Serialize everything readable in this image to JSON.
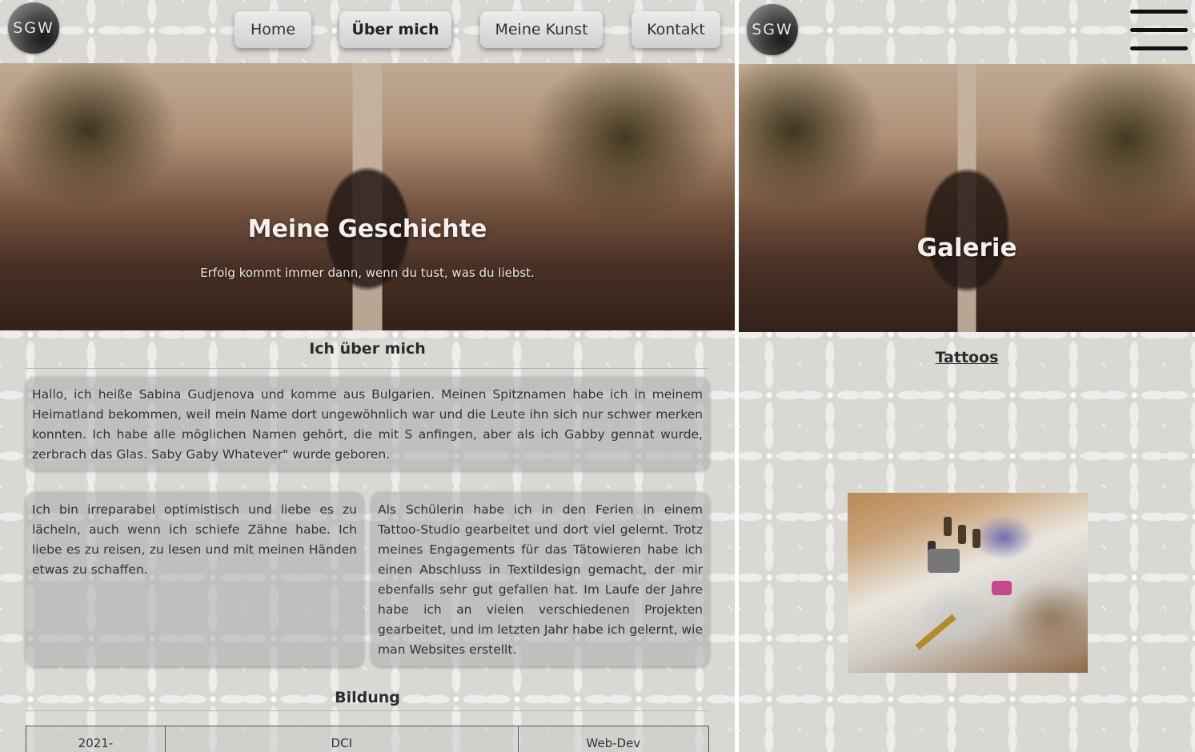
{
  "left": {
    "logo": "SGW",
    "nav": [
      {
        "label": "Home",
        "active": false
      },
      {
        "label": "Über mich",
        "active": true
      },
      {
        "label": "Meine Kunst",
        "active": false
      },
      {
        "label": "Kontakt",
        "active": false
      }
    ],
    "hero": {
      "title": "Meine Geschichte",
      "subtitle": "Erfolg kommt immer dann, wenn du tust, was du liebst."
    },
    "about": {
      "heading": "Ich über mich",
      "intro": "Hallo, ich heiße Sabina Gudjenova und komme aus Bulgarien. Meinen Spitznamen habe ich in meinem Heimatland bekommen, weil mein Name dort ungewöhnlich war und die Leute ihn sich nur schwer merken konnten. Ich habe alle möglichen Namen gehört, die mit S anfingen, aber als ich Gabby gennat wurde, zerbrach das Glas. Saby Gaby Whatever\" wurde geboren.",
      "col_left": "Ich bin irreparabel optimistisch und liebe es zu lächeln, auch wenn ich schiefe Zähne habe. Ich liebe es zu reisen, zu lesen und mit meinen Händen etwas zu schaffen.",
      "col_right": "Als Schülerin habe ich in den Ferien in einem Tattoo-Studio gearbeitet und dort viel gelernt. Trotz meines Engagements für das Tätowieren habe ich einen Abschluss in Textildesign gemacht, der mir ebenfalls sehr gut gefallen hat. Im Laufe der Jahre habe ich an vielen verschiedenen Projekten gearbeitet, und im letzten Jahr habe ich gelernt, wie man Websites erstellt."
    },
    "education": {
      "heading": "Bildung",
      "rows": [
        {
          "year": "2021-",
          "school": "DCI",
          "subject": "Web-Dev"
        }
      ]
    }
  },
  "right": {
    "logo": "SGW",
    "menu_icon": "hamburger-menu-icon",
    "hero": {
      "title": "Galerie"
    },
    "gallery": {
      "heading": "Tattoos"
    }
  },
  "colors": {
    "pattern_bg": "#d9d8d3",
    "card_bg": "#afafaf",
    "text": "#333333"
  }
}
